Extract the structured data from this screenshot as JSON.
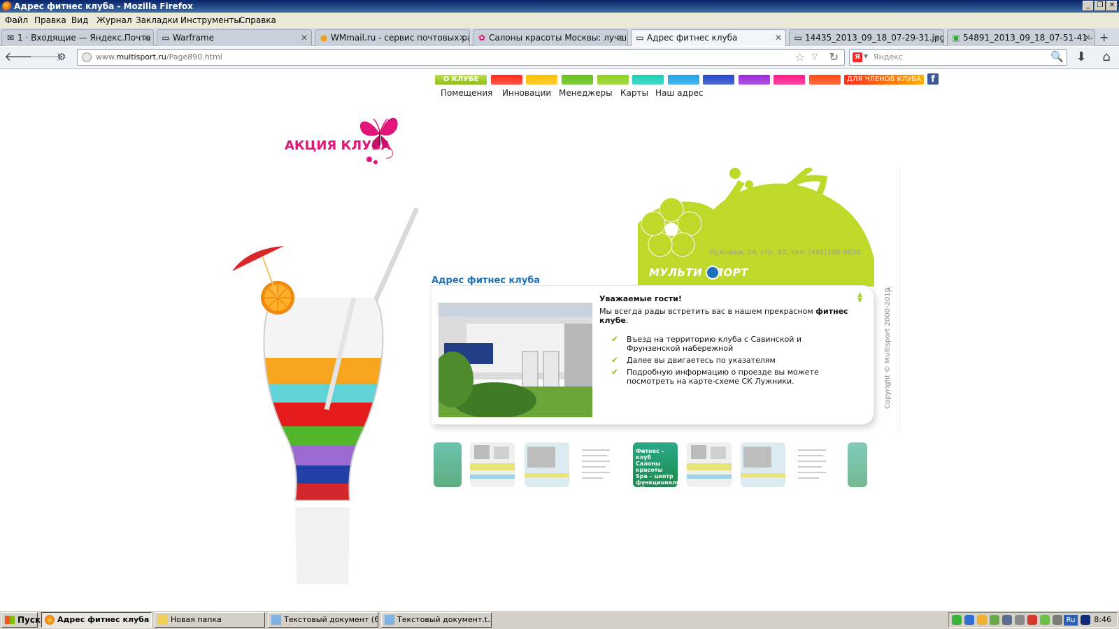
{
  "window": {
    "title": "Адрес фитнес клуба - Mozilla Firefox",
    "controls": {
      "minimize": "_",
      "maximize": "❐",
      "close": "✕"
    }
  },
  "menu": [
    "Файл",
    "Правка",
    "Вид",
    "Журнал",
    "Закладки",
    "Инструменты",
    "Справка"
  ],
  "tabs": [
    {
      "label": "1 · Входящие — Яндекс.Почта",
      "icon": "mail-icon"
    },
    {
      "label": "Warframe",
      "icon": "page-icon"
    },
    {
      "label": "WMmail.ru - сервис почтовых расс...",
      "icon": "wmmail-icon"
    },
    {
      "label": "Салоны красоты Москвы: лучшие...",
      "icon": "flower-icon"
    },
    {
      "label": "Адрес фитнес клуба",
      "icon": "page-icon",
      "active": true
    },
    {
      "label": "14435_2013_09_18_07-29-31.jpg (...",
      "icon": "image-icon"
    },
    {
      "label": "54891_2013_09_18_07-51-41 - За...",
      "icon": "image-icon"
    }
  ],
  "tab_close": "✕",
  "new_tab": "+",
  "nav": {
    "back": "🡐",
    "forward": "🡒",
    "history": "⚙",
    "url_prefix": "www.",
    "url_domain": "multisport.ru",
    "url_path": "/Page890.html",
    "bookmark_star": "☆",
    "dropdown": "▽",
    "reload": "↻",
    "search_engine": "Я",
    "search_placeholder": "Яндекс",
    "search_button": "🔍",
    "download": "⬇",
    "home": "⌂"
  },
  "site": {
    "nav_main": "О КЛУБЕ",
    "nav_members": "ДЛЯ ЧЛЕНОВ КЛУБА",
    "facebook": "f",
    "subnav": [
      "Помещения",
      "Инновации",
      "Менеджеры",
      "Карты",
      "Наш адрес"
    ],
    "promo": "АКЦИЯ КЛУБА",
    "address_small": "Лужники, 24, стр. 10, тел: (495)788-9898",
    "logo": "МУЛЬТИ СПОРТ",
    "heading": "Адрес фитнес клуба",
    "greeting": "Уважаемые гости!",
    "intro_plain": "Мы всегда рады встретить вас в нашем прекрасном ",
    "intro_bold": "фитнес клубе",
    "intro_end": ".",
    "bullets": [
      "Въезд на территорию клуба с Савинской и Фрунзенской набережной",
      "Далее вы двигаетесь по указателям",
      "Подробную информацию о проезде вы можете посмотреть на карте-схеме СК Лужники."
    ],
    "scroll_up": "▲",
    "scroll_down": "▼",
    "copyright": "Copyright © Multisport 2000-2010",
    "copyright_arrow": "↸",
    "thumb_green_text": "Фитнес – клуб Салоны красоты Spa – центр функциональный «Мультидоктор»"
  },
  "colors": {
    "accent_green": "#8fc21d",
    "brand_pink": "#e2167a",
    "heading_blue": "#1f72b7",
    "colorbar": [
      "#ff2a1a",
      "#ffc000",
      "#64c018",
      "#8ecf1e",
      "#1ccfb5",
      "#1fa4e8",
      "#2446c8",
      "#9a2bd8",
      "#ff1a8a",
      "#ff4a12"
    ]
  },
  "taskbar": {
    "start": "Пуск",
    "tasks": [
      {
        "label": "Адрес фитнес клуба ...",
        "active": true,
        "icon": "firefox-icon"
      },
      {
        "label": "Новая папка",
        "icon": "folder-icon"
      },
      {
        "label": "Текстовый документ (6...",
        "icon": "notepad-icon"
      },
      {
        "label": "Текстовый документ.t...",
        "icon": "notepad-icon"
      }
    ],
    "lang": "Ru",
    "clock": "8:46"
  }
}
